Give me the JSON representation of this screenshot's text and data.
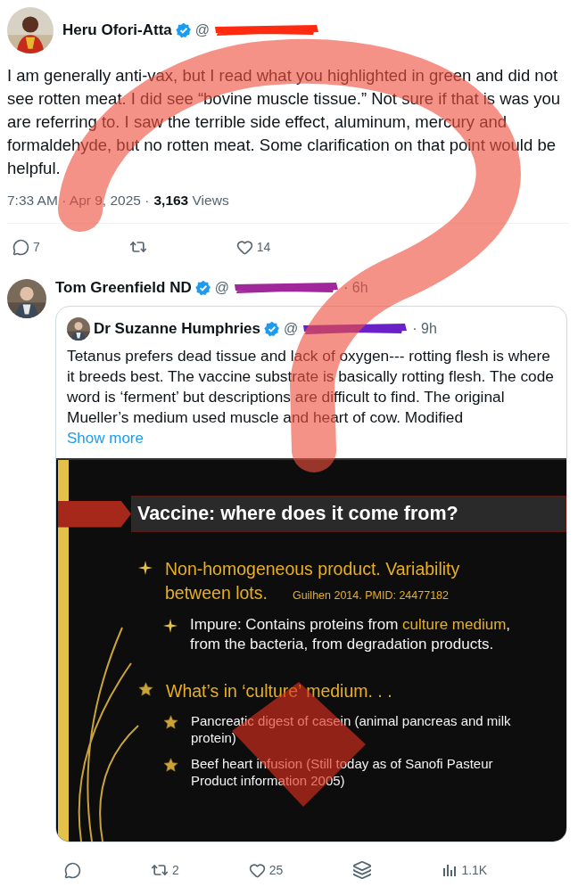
{
  "tweet": {
    "author": {
      "name": "Heru Ofori-Atta",
      "verified": true,
      "handle_prefix": "@"
    },
    "text": "I am generally anti-vax, but I read what you highlighted in green and did not see rotten meat. I did see “bovine muscle tissue.” Not sure if that is was you are referring to. I saw the terrible side effect, aluminum, mercury and formaldehyde, but no rotten meat. Some clarification on that point would be helpful.",
    "time": "7:33 AM",
    "separator": "·",
    "date": "Apr 9, 2025",
    "views_count": "3,163",
    "views_label": "Views",
    "actions": [
      {
        "kind": "reply",
        "count": "7"
      },
      {
        "kind": "repost"
      },
      {
        "kind": "like",
        "count": "14"
      }
    ]
  },
  "reply": {
    "author": {
      "name": "Tom Greenfield ND",
      "verified": true,
      "handle_prefix": "@",
      "separator": "·",
      "time": "6h"
    },
    "quote": {
      "author": {
        "name": "Dr Suzanne Humphries",
        "verified": true,
        "handle_prefix": "@",
        "separator": "·",
        "time": "9h"
      },
      "text": "Tetanus prefers dead tissue and lack of oxygen--- rotting flesh is where it breeds best. The vaccine substrate is basically rotting flesh. The code word is ‘ferment’ but descriptions are difficult to find. The original Mueller’s medium used muscle and heart of cow. Modified",
      "show_more": "Show more",
      "slide": {
        "title": "Vaccine: where does it come from?",
        "items": [
          {
            "kind": "sparkle",
            "parts": [
              {
                "text": "Non-homogeneous product. Variability between lots.",
                "highlight": true
              }
            ],
            "citation": "Guilhen 2014. PMID: 24477182",
            "children": [
              {
                "kind": "sparkle",
                "parts": [
                  {
                    "text": "Impure: Contains proteins from ",
                    "highlight": false
                  },
                  {
                    "text": "culture medium",
                    "highlight": true
                  },
                  {
                    "text": ", from the bacteria, from degradation products.",
                    "highlight": false
                  }
                ]
              }
            ]
          },
          {
            "kind": "star",
            "parts": [
              {
                "text": "What’s in ‘culture’ medium. . .",
                "highlight": true
              }
            ],
            "children": [
              {
                "kind": "star",
                "parts": [
                  {
                    "text": "Pancreatic digest of casein (animal pancreas and milk protein)",
                    "highlight": false
                  }
                ]
              },
              {
                "kind": "star",
                "parts": [
                  {
                    "text": "Beef heart infusion (Still today as of Sanofi Pasteur Product information 2005)",
                    "highlight": false
                  }
                ]
              }
            ]
          }
        ]
      }
    },
    "actions": [
      {
        "kind": "reply"
      },
      {
        "kind": "repost",
        "count": "2"
      },
      {
        "kind": "like",
        "count": "25"
      },
      {
        "kind": "bookmark"
      },
      {
        "kind": "views",
        "count": "1.1K"
      }
    ]
  }
}
